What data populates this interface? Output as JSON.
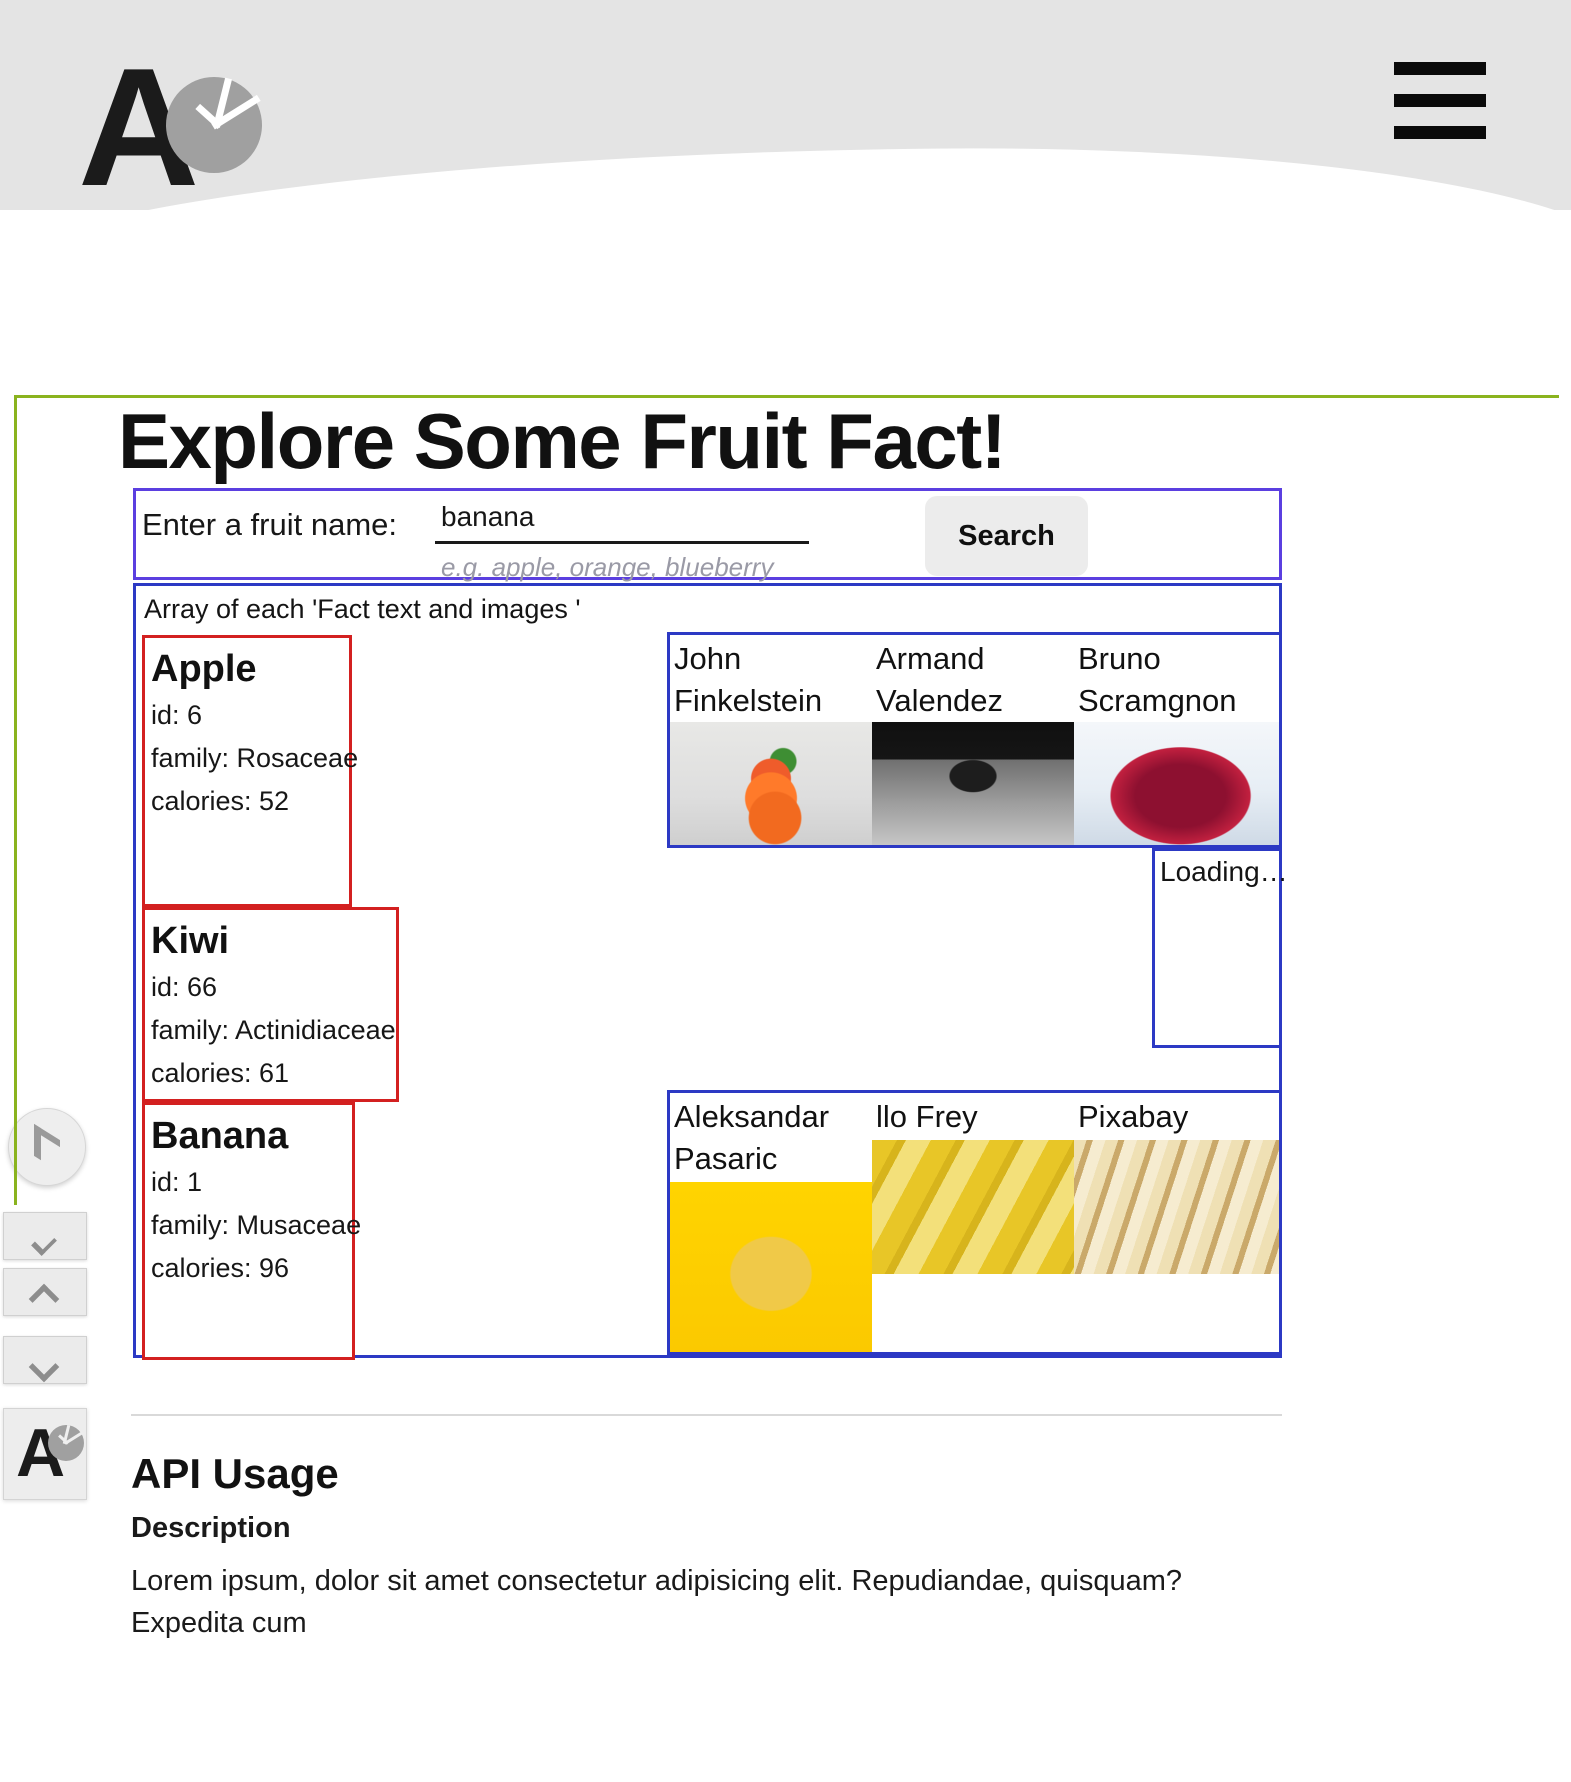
{
  "header": {
    "logo_letter": "A",
    "logo_icon": "pie-chart-icon",
    "menu_icon": "hamburger-menu-icon"
  },
  "left_rail": {
    "logo_icon": "arrow-chevron-logo-icon",
    "collapse_icon": "collapse-double-chevron-icon",
    "up_icon": "chevron-up-icon",
    "down_icon": "chevron-down-icon",
    "brand_letter": "A"
  },
  "main": {
    "page_title": "Explore Some Fruit Fact!",
    "search": {
      "label": "Enter a fruit name:",
      "value": "banana",
      "placeholder": "e.g. apple, orange, blueberry",
      "hint": "e.g. apple, orange, blueberry",
      "button_label": "Search"
    },
    "results_caption": "Array of each 'Fact text and images '",
    "fruit_cards": [
      {
        "name": "Apple",
        "id_line": "id: 6",
        "family_line": "family: Rosaceae",
        "calories_line": "calories: 52"
      },
      {
        "name": "Kiwi",
        "id_line": "id: 66",
        "family_line": "family: Actinidiaceae",
        "calories_line": "calories: 61"
      },
      {
        "name": "Banana",
        "id_line": "id: 1",
        "family_line": "family: Musaceae",
        "calories_line": "calories: 96"
      }
    ],
    "credits_top": [
      {
        "name": "John Finkelstein",
        "photo": "sliced-apple-photo"
      },
      {
        "name": "Armand Valendez",
        "photo": "imac-apple-logo-photo"
      },
      {
        "name": "Bruno Scramgnon",
        "photo": "red-apple-photo"
      }
    ],
    "loading_text": "Loading…",
    "credits_bottom": [
      {
        "name": "Aleksandar Pasaric",
        "photo": "banana-bowl-photo"
      },
      {
        "name": "llo Frey",
        "photo": "banana-bunch-photo"
      },
      {
        "name": "Pixabay",
        "photo": "peeled-banana-dark-photo"
      }
    ]
  },
  "footer_section": {
    "title": "API Usage",
    "subtitle": "Description",
    "body": "Lorem ipsum, dolor sit amet consectetur adipisicing elit. Repudiandae, quisquam? Expedita cum"
  },
  "colors": {
    "header_bg": "#e4e4e4",
    "accent_green": "#8ab31e",
    "form_border": "#5b3fe0",
    "results_border": "#2c39c4",
    "card_border": "#d32020"
  }
}
